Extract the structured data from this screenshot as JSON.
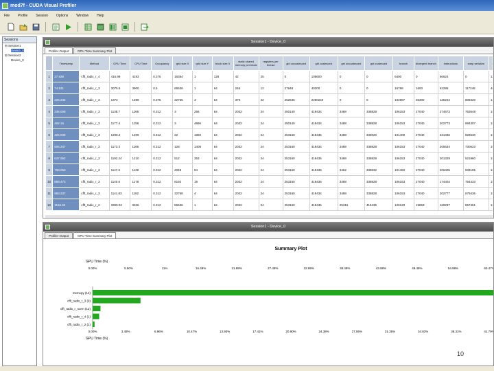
{
  "window": {
    "title": "mod7f - CUDA Visual Profiler"
  },
  "menu": [
    "File",
    "Profile",
    "Session",
    "Options",
    "Window",
    "Help"
  ],
  "toolbar": {
    "icons": [
      "new-icon",
      "open-icon",
      "save-icon",
      "session-settings-icon",
      "start-icon",
      "profiler-output-icon",
      "summary-table-icon",
      "kernel-table-icon",
      "gpu-time-plot-icon",
      "export-icon"
    ]
  },
  "left_pane": {
    "title": "Sessions",
    "tree": [
      {
        "label": "Session1",
        "indent": 0
      },
      {
        "label": "Device_0",
        "indent": 1,
        "selected": true
      },
      {
        "label": "Session2",
        "indent": 0
      },
      {
        "label": "Device_0",
        "indent": 1
      }
    ]
  },
  "top_panel": {
    "title": "Session1 - Device_0",
    "tabs": [
      "Profiler Output",
      "GPU Time Summary Plot"
    ],
    "columns": [
      "",
      "Timestamp",
      "Method",
      "GPU Time",
      "CPU Time",
      "Occupancy",
      "grid size X",
      "grid size Y",
      "block size X",
      "static shared memory per block",
      "registers per thread",
      "gld uncoalesced",
      "gld coalesced",
      "gst uncoalesced",
      "gst coalesced",
      "branch",
      "divergent branch",
      "instructions",
      "warp serialize",
      "cta launched"
    ],
    "rows": [
      [
        "1",
        "27.936",
        "cfft_radix_r_4",
        "416.99",
        "4193",
        "0.375",
        "16384",
        "1",
        "128",
        "42",
        "25",
        "0",
        "105600",
        "0",
        "0",
        "6400",
        "0",
        "66624",
        "0",
        "1152"
      ],
      [
        "2",
        "74.531",
        "cfft_radix_r_3",
        "3075.5",
        "3900",
        "0.5",
        "65536",
        "1",
        "64",
        "246",
        "12",
        "27648",
        "40300",
        "0",
        "0",
        "16768",
        "1600",
        "62286",
        "117248",
        "4096"
      ],
      [
        "3",
        "226.232",
        "cfft_radix_r_3",
        "1372",
        "1399",
        "0.375",
        "22765",
        "4",
        "64",
        "370",
        "22",
        "262536",
        "2250240",
        "0",
        "0",
        "102987",
        "36300",
        "125222",
        "808320",
        "1360"
      ],
      [
        "4",
        "336.009",
        "cfft_radix_r_3",
        "1138.7",
        "1166",
        "0.312",
        "3",
        "256",
        "64",
        "2032",
        "24",
        "250140",
        "419434",
        "3488",
        "338828",
        "106153",
        "27040",
        "274673",
        "763648",
        "1536"
      ],
      [
        "5",
        "404.16",
        "cfft_radix_r_3",
        "1177.4",
        "1158",
        "0.312",
        "3",
        "4896",
        "64",
        "2032",
        "24",
        "250140",
        "419434",
        "3488",
        "338828",
        "106153",
        "27040",
        "202773",
        "994307",
        "1536"
      ],
      [
        "6",
        "425.039",
        "cfft_radix_r_3",
        "1206.2",
        "1209",
        "0.312",
        "22",
        "1860",
        "64",
        "2032",
        "24",
        "253160",
        "419435",
        "3488",
        "339020",
        "101400",
        "27040",
        "231436",
        "829630",
        "1536"
      ],
      [
        "7",
        "506.347",
        "cfft_radix_r_3",
        "1173.4",
        "1166",
        "0.312",
        "128",
        "1408",
        "64",
        "2032",
        "24",
        "253160",
        "419434",
        "3488",
        "338828",
        "106153",
        "27040",
        "205634",
        "730623",
        "1536"
      ],
      [
        "8",
        "637.062",
        "cfft_radix_r_3",
        "1192.24",
        "1210",
        "0.312",
        "512",
        "353",
        "64",
        "2032",
        "24",
        "253160",
        "419435",
        "3488",
        "338828",
        "106153",
        "27040",
        "201329",
        "621960",
        "1536"
      ],
      [
        "9",
        "758.063",
        "cfft_radix_r_3",
        "1147.5",
        "1139",
        "0.312",
        "2048",
        "94",
        "64",
        "2032",
        "24",
        "253160",
        "419435",
        "3462",
        "338632",
        "101460",
        "27040",
        "206405",
        "933105",
        "1536"
      ],
      [
        "10",
        "869.473",
        "cfft_radix_r_3",
        "1140.6",
        "1178",
        "0.312",
        "8192",
        "19",
        "64",
        "2032",
        "24",
        "253160",
        "419435",
        "3488",
        "338828",
        "106153",
        "27040",
        "174404",
        "754433",
        "1536"
      ],
      [
        "11",
        "983.237",
        "cfft_radix_r_3",
        "1141.83",
        "1182",
        "0.312",
        "32768",
        "4",
        "64",
        "2032",
        "24",
        "253160",
        "419434",
        "3488",
        "338828",
        "106153",
        "27040",
        "202777",
        "679436",
        "1536"
      ],
      [
        "12",
        "1166.83",
        "cfft_radix_r_2",
        "3300.02",
        "3326",
        "0.312",
        "65536",
        "1",
        "64",
        "2032",
        "24",
        "253160",
        "419435",
        "25316",
        "419435",
        "126120",
        "19853",
        "169237",
        "657461",
        "1536"
      ]
    ]
  },
  "bottom_panel": {
    "title": "Session1 - Device_0",
    "tabs": [
      "Profiler Output",
      "GPU Time Summary Plot"
    ],
    "chart_data": {
      "type": "bar",
      "orientation": "horizontal",
      "title": "Summary Plot",
      "xlabel": "GPU Time (%)",
      "categories": [
        "memcpy (12)",
        "cfft_radix_r_3 (9)",
        "cfft_radix_r_norm (12)",
        "cfft_radix_r_4 (1)",
        "cfft_radix_r_2 (1)"
      ],
      "values": [
        93.8,
        7.3,
        1.2,
        1.0,
        0.3
      ],
      "xlim": [
        0,
        60.47
      ],
      "xticks": [
        "0.00%",
        "3.48%",
        "6.96%",
        "10.47%",
        "13.93%",
        "17.41%",
        "20.90%",
        "24.38%",
        "27.86%",
        "31.35%",
        "34.83%",
        "38.31%",
        "41.79%"
      ],
      "xticks_top": [
        "0.00%",
        "5.50%",
        "11%",
        "16.49%",
        "21.99%",
        "27.49%",
        "32.99%",
        "38.48%",
        "43.98%",
        "49.48%",
        "54.98%",
        "60.47%"
      ],
      "bar_color": "#22a81e"
    }
  },
  "page_number": "10"
}
